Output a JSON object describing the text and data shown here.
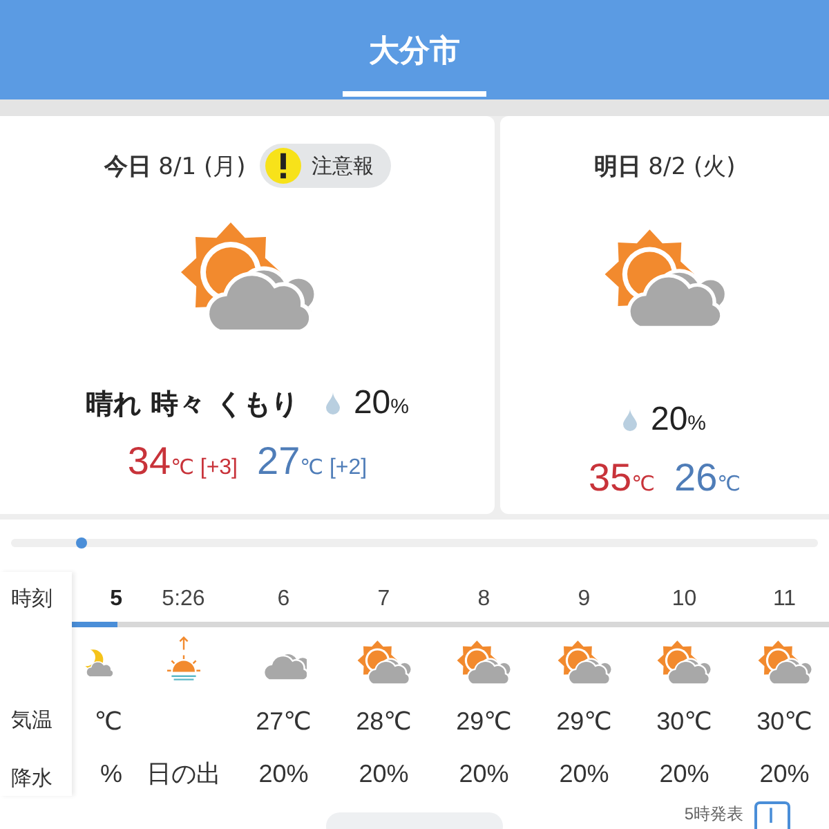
{
  "header": {
    "title": "大分市"
  },
  "days": [
    {
      "label": "今日",
      "date": "8/1 (月)",
      "alert": "注意報",
      "weather": "晴れ 時々 くもり",
      "kind": "sun_cloud",
      "rain": "20",
      "rain_unit": "%",
      "high": "34",
      "high_unit": "℃",
      "high_diff": "[+3]",
      "low": "27",
      "low_unit": "℃",
      "low_diff": "[+2]"
    },
    {
      "label": "明日",
      "date": "8/2 (火)",
      "kind": "sun_cloud",
      "rain": "20",
      "rain_unit": "%",
      "high": "35",
      "high_unit": "℃",
      "low": "26",
      "low_unit": "℃"
    }
  ],
  "hourly": {
    "labels": [
      "時刻",
      "気温",
      "降水"
    ],
    "progress": {
      "level": 0.06
    },
    "hours": [
      {
        "time": "5",
        "current": true,
        "kind": "moon_cloud",
        "temp": "℃",
        "rain": "%"
      },
      {
        "time": "5:26",
        "current": false,
        "kind": "sunrise",
        "rain": "日の出"
      },
      {
        "time": "6",
        "current": false,
        "kind": "cloudy",
        "temp": "27℃",
        "rain": "20%"
      },
      {
        "time": "7",
        "current": false,
        "kind": "sun_cloud",
        "temp": "28℃",
        "rain": "20%"
      },
      {
        "time": "8",
        "current": false,
        "kind": "sun_cloud",
        "temp": "29℃",
        "rain": "20%"
      },
      {
        "time": "9",
        "current": false,
        "kind": "sun_cloud",
        "temp": "29℃",
        "rain": "20%"
      },
      {
        "time": "10",
        "current": false,
        "kind": "sun_cloud",
        "temp": "30℃",
        "rain": "20%"
      },
      {
        "time": "11",
        "current": false,
        "kind": "sun_cloud",
        "temp": "30℃",
        "rain": "20%"
      }
    ]
  },
  "footer": {
    "issued": "5時発表"
  }
}
